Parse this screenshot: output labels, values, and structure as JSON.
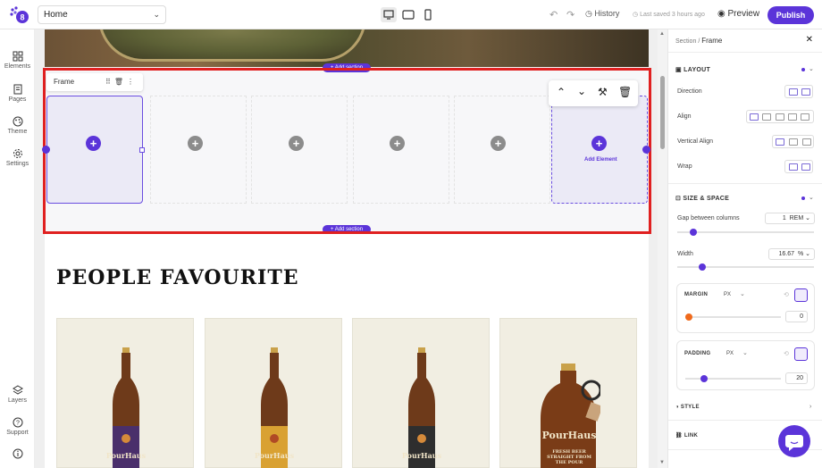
{
  "topbar": {
    "page_name": "Home",
    "history_label": "History",
    "saved_status": "Last saved 3 hours ago",
    "preview_label": "Preview",
    "publish_label": "Publish",
    "devices": [
      "desktop-icon",
      "tablet-icon",
      "mobile-icon"
    ],
    "active_device": "desktop"
  },
  "leftbar": {
    "items": [
      {
        "label": "Elements",
        "icon": "grid-icon"
      },
      {
        "label": "Pages",
        "icon": "page-icon"
      },
      {
        "label": "Theme",
        "icon": "palette-icon"
      },
      {
        "label": "Settings",
        "icon": "gear-icon"
      }
    ],
    "bottom_items": [
      {
        "label": "Layers",
        "icon": "layers-icon"
      },
      {
        "label": "Support",
        "icon": "help-icon"
      },
      {
        "label": "",
        "icon": "info-icon"
      }
    ]
  },
  "canvas": {
    "add_section_label": "+ Add section",
    "frame_tag_label": "Frame",
    "add_element_label": "Add Element",
    "section_title": "PEOPLE FAVOURITE",
    "product_label_text": [
      "PourHaus",
      "PourHaus",
      "PourHaus",
      "PourHaus"
    ],
    "growler_subtext": "FRESH BEER STRAIGHT FROM THE POUR"
  },
  "panel": {
    "breadcrumb_root": "Section",
    "breadcrumb_sep": "/",
    "breadcrumb_current": "Frame",
    "layout_heading": "LAYOUT",
    "direction_label": "Direction",
    "align_label": "Align",
    "vertical_align_label": "Vertical Align",
    "wrap_label": "Wrap",
    "size_heading": "SIZE & SPACE",
    "gap_label": "Gap between columns",
    "gap_value": "1",
    "gap_unit": "REM",
    "gap_level": 0.12,
    "width_label": "Width",
    "width_value": "16.67",
    "width_unit": "%",
    "width_level": 0.18,
    "margin_label": "MARGIN",
    "margin_unit": "PX",
    "margin_value": "0",
    "margin_level": 0.0,
    "padding_label": "PADDING",
    "padding_unit": "PX",
    "padding_value": "20",
    "padding_level": 0.2,
    "style_label": "STYLE",
    "link_label": "LINK",
    "accent_color": "#5b34d9",
    "margin_dot_color": "#f06a1c"
  }
}
